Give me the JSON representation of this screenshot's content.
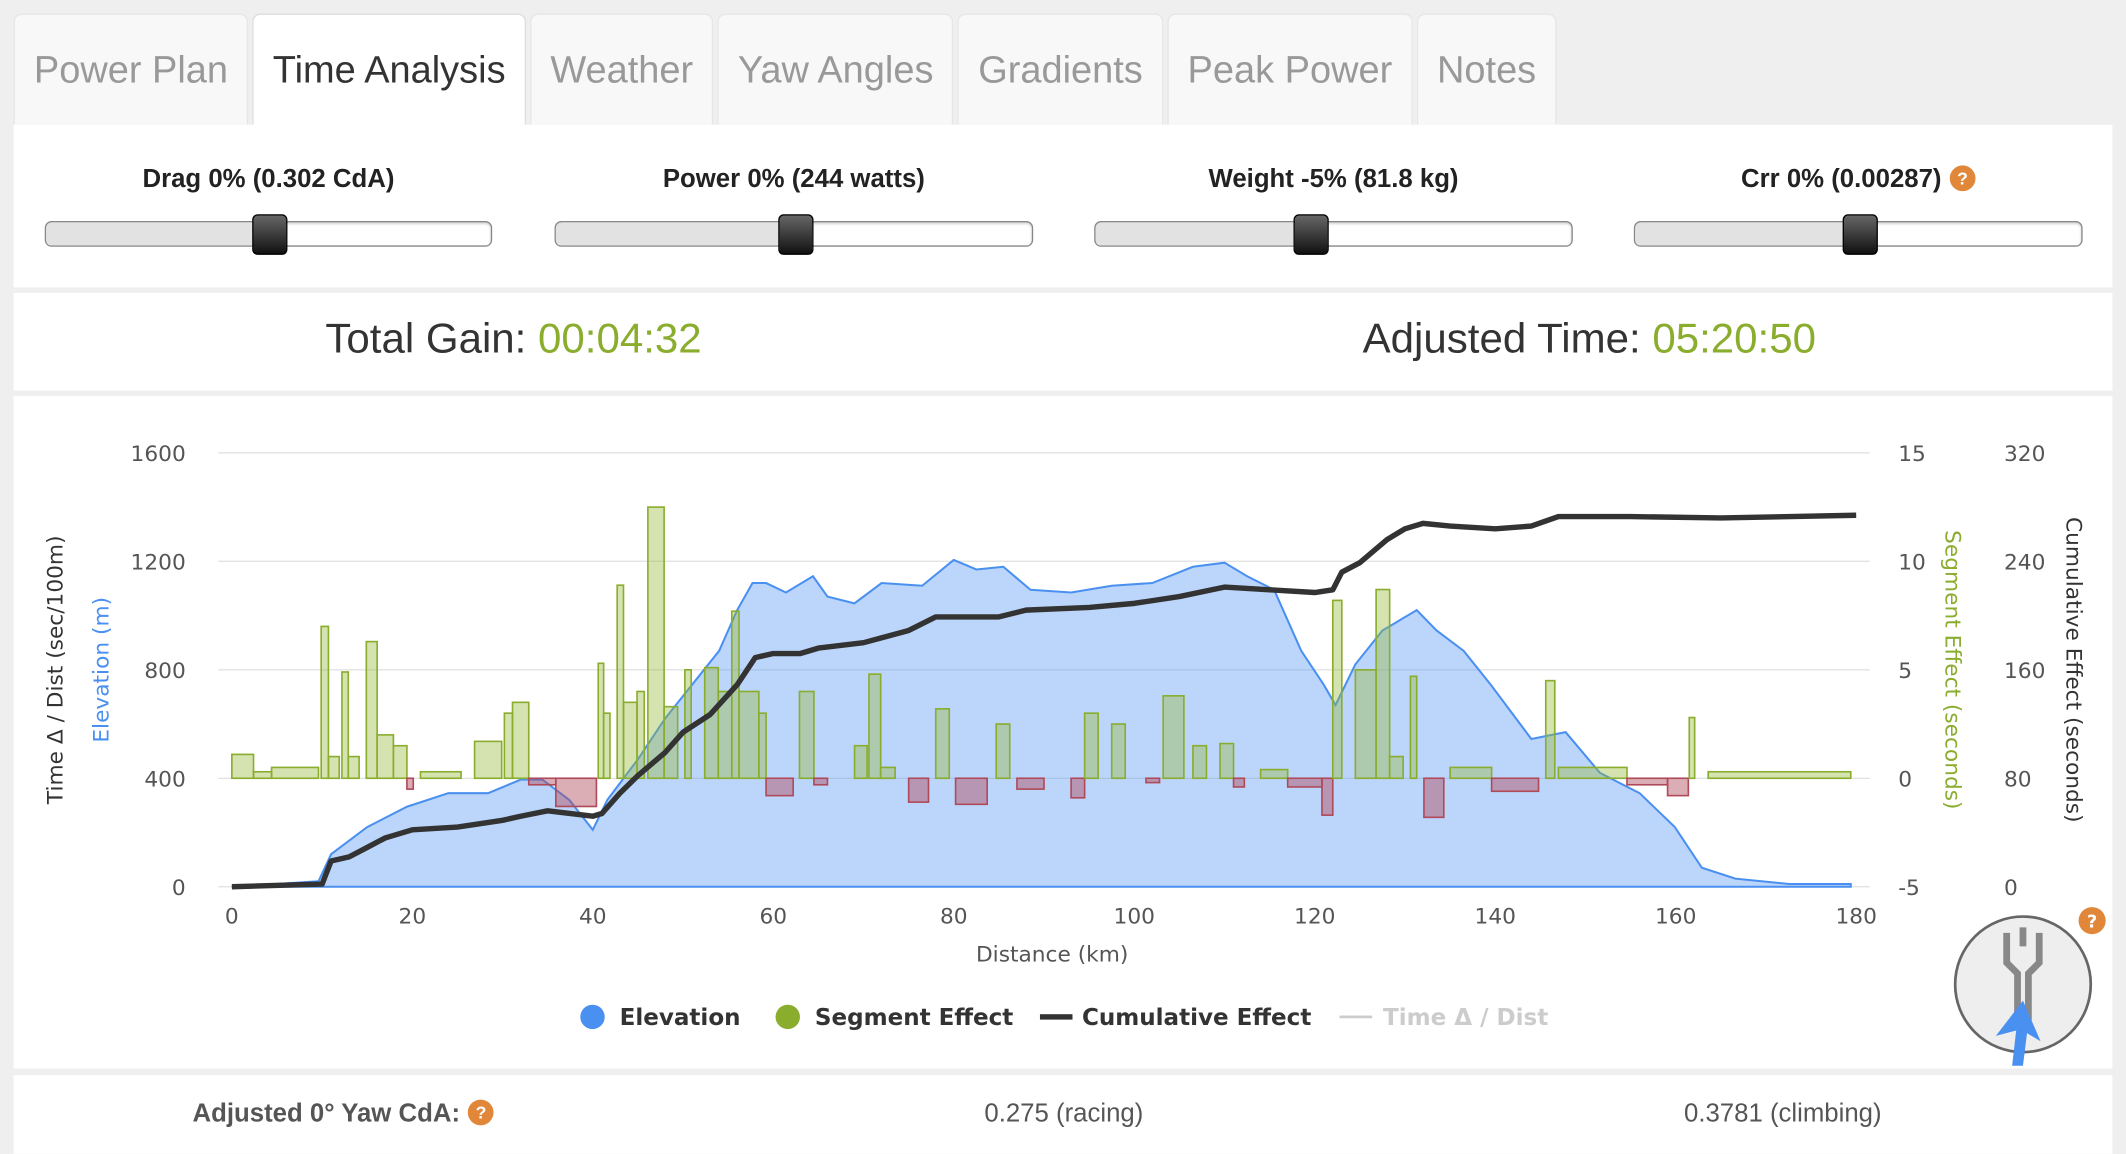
{
  "tabs": [
    {
      "label": "Power Plan"
    },
    {
      "label": "Time Analysis",
      "active": true
    },
    {
      "label": "Weather"
    },
    {
      "label": "Yaw Angles"
    },
    {
      "label": "Gradients"
    },
    {
      "label": "Peak Power"
    },
    {
      "label": "Notes"
    }
  ],
  "sliders": [
    {
      "label": "Drag 0% (0.302 CdA)",
      "position": 0.5
    },
    {
      "label": "Power 0% (244 watts)",
      "position": 0.5
    },
    {
      "label": "Weight -5% (81.8 kg)",
      "position": 0.45
    },
    {
      "label": "Crr 0% (0.00287)",
      "position": 0.5,
      "help": "?"
    }
  ],
  "totals": {
    "gain_label": "Total Gain:",
    "gain_value": "00:04:32",
    "adjusted_label": "Adjusted Time:",
    "adjusted_value": "05:20:50"
  },
  "colors": {
    "accent_green": "#8aad2e",
    "elevation_blue": "#4a90f0",
    "negative_red": "#b04a5a",
    "help_orange": "#e0873a"
  },
  "chart_data": {
    "type": "area",
    "xlabel": "Distance (km)",
    "xlim": [
      0,
      180
    ],
    "xticks": [
      "0",
      "20",
      "40",
      "60",
      "80",
      "100",
      "120",
      "140",
      "160",
      "180"
    ],
    "y_left_labels": [
      "Time Δ / Dist (sec/100m)",
      "Elevation (m)"
    ],
    "y_left_ticks": [
      "0",
      "400",
      "800",
      "1200",
      "1600"
    ],
    "y_left_lim": [
      0,
      1600
    ],
    "y_seg_label": "Segment Effect (seconds)",
    "y_seg_ticks": [
      "-5",
      "0",
      "5",
      "10",
      "15"
    ],
    "y_seg_lim": [
      -5,
      15
    ],
    "y_cum_label": "Cumulative Effect (seconds)",
    "y_cum_ticks": [
      "0",
      "80",
      "160",
      "240",
      "320"
    ],
    "y_cum_lim": [
      0,
      320
    ],
    "grid": true,
    "legend_position": "bottom",
    "legend": [
      {
        "name": "Elevation",
        "color": "#4a90f0"
      },
      {
        "name": "Segment Effect",
        "color": "#8aad2e"
      },
      {
        "name": "Cumulative Effect",
        "color": "#333333"
      },
      {
        "name": "Time Δ / Dist",
        "color": "#cccccc",
        "hidden": true
      }
    ],
    "elevation": [
      [
        0,
        0
      ],
      [
        9.6,
        20
      ],
      [
        11,
        120
      ],
      [
        15,
        220
      ],
      [
        19.4,
        295
      ],
      [
        24,
        345
      ],
      [
        28.4,
        345
      ],
      [
        32,
        395
      ],
      [
        34.4,
        395
      ],
      [
        37.4,
        320
      ],
      [
        40,
        210
      ],
      [
        41.6,
        320
      ],
      [
        45,
        470
      ],
      [
        48,
        620
      ],
      [
        51,
        745
      ],
      [
        54,
        870
      ],
      [
        56,
        1020
      ],
      [
        57.7,
        1120
      ],
      [
        59.2,
        1120
      ],
      [
        61.4,
        1085
      ],
      [
        64.4,
        1145
      ],
      [
        66,
        1070
      ],
      [
        69,
        1045
      ],
      [
        72,
        1120
      ],
      [
        76.5,
        1110
      ],
      [
        80,
        1205
      ],
      [
        82.5,
        1170
      ],
      [
        85.5,
        1180
      ],
      [
        88.5,
        1095
      ],
      [
        93,
        1085
      ],
      [
        97.5,
        1110
      ],
      [
        102,
        1120
      ],
      [
        106.5,
        1180
      ],
      [
        110,
        1195
      ],
      [
        112.5,
        1145
      ],
      [
        115.5,
        1095
      ],
      [
        118.5,
        870
      ],
      [
        121,
        745
      ],
      [
        122.3,
        670
      ],
      [
        124.5,
        820
      ],
      [
        127.5,
        945
      ],
      [
        131.3,
        1020
      ],
      [
        133.5,
        945
      ],
      [
        136.5,
        870
      ],
      [
        139.5,
        745
      ],
      [
        144,
        545
      ],
      [
        147.8,
        570
      ],
      [
        151.6,
        420
      ],
      [
        156,
        345
      ],
      [
        159.9,
        220
      ],
      [
        162.9,
        70
      ],
      [
        166.6,
        30
      ],
      [
        172.6,
        10
      ],
      [
        179.4,
        10
      ]
    ],
    "segment_effect": [
      [
        0,
        2.4,
        1.1
      ],
      [
        2.4,
        4.4,
        0.3
      ],
      [
        4.4,
        9.6,
        0.5
      ],
      [
        9.9,
        10.7,
        7
      ],
      [
        10.7,
        11.9,
        1
      ],
      [
        12.2,
        12.9,
        4.9
      ],
      [
        12.9,
        14.1,
        1
      ],
      [
        14.9,
        16.1,
        6.3
      ],
      [
        16.1,
        17.9,
        2
      ],
      [
        17.9,
        19.4,
        1.5
      ],
      [
        19.4,
        20.1,
        -0.5
      ],
      [
        20.9,
        25.4,
        0.3
      ],
      [
        26.9,
        29.9,
        1.7
      ],
      [
        30.2,
        31.1,
        3
      ],
      [
        31.1,
        32.9,
        3.5
      ],
      [
        32.9,
        35.9,
        -0.3
      ],
      [
        35.9,
        40.4,
        -1.3
      ],
      [
        40.6,
        41.2,
        5.3
      ],
      [
        41.2,
        41.9,
        3
      ],
      [
        42.7,
        43.4,
        8.9
      ],
      [
        43.4,
        44.9,
        3.5
      ],
      [
        44.9,
        45.7,
        4
      ],
      [
        46.1,
        47.9,
        12.5
      ],
      [
        47.9,
        49.4,
        3.3
      ],
      [
        50.2,
        50.9,
        5
      ],
      [
        52.4,
        53.9,
        5.1
      ],
      [
        53.9,
        55.4,
        4
      ],
      [
        55.4,
        56.2,
        7.7
      ],
      [
        56.2,
        58.4,
        4
      ],
      [
        58.4,
        59.2,
        3
      ],
      [
        59.2,
        62.2,
        -0.8
      ],
      [
        62.9,
        64.5,
        4
      ],
      [
        64.5,
        66,
        -0.3
      ],
      [
        69,
        70.4,
        1.5
      ],
      [
        70.6,
        71.9,
        4.8
      ],
      [
        71.9,
        73.5,
        0.5
      ],
      [
        75,
        77.2,
        -1.1
      ],
      [
        78,
        79.5,
        3.2
      ],
      [
        80.2,
        83.7,
        -1.2
      ],
      [
        84.7,
        86.2,
        2.5
      ],
      [
        87,
        90,
        -0.5
      ],
      [
        93,
        94.5,
        -0.9
      ],
      [
        94.5,
        96,
        3
      ],
      [
        97.5,
        99,
        2.5
      ],
      [
        101.3,
        102.8,
        -0.2
      ],
      [
        103.2,
        105.5,
        3.8
      ],
      [
        106.5,
        108,
        1.5
      ],
      [
        109.5,
        111,
        1.6
      ],
      [
        111,
        112.2,
        -0.4
      ],
      [
        114,
        117,
        0.4
      ],
      [
        117,
        120.8,
        -0.4
      ],
      [
        120.8,
        122,
        -1.7
      ],
      [
        122,
        123,
        8.2
      ],
      [
        124.5,
        126.8,
        5
      ],
      [
        126.8,
        128.3,
        8.7
      ],
      [
        128.3,
        129.8,
        1
      ],
      [
        130.6,
        131.3,
        4.7
      ],
      [
        132.1,
        134.3,
        -1.8
      ],
      [
        135,
        139.6,
        0.5
      ],
      [
        139.6,
        144.8,
        -0.6
      ],
      [
        145.6,
        146.6,
        4.5
      ],
      [
        147,
        154.6,
        0.5
      ],
      [
        154.6,
        159.1,
        -0.3
      ],
      [
        159.1,
        161.4,
        -0.8
      ],
      [
        161.5,
        162.1,
        2.8
      ],
      [
        163.6,
        179.4,
        0.3
      ]
    ],
    "cumulative_effect": [
      [
        0,
        0
      ],
      [
        10,
        2
      ],
      [
        11,
        19
      ],
      [
        13,
        22
      ],
      [
        15,
        29
      ],
      [
        17,
        36
      ],
      [
        20,
        42
      ],
      [
        25,
        44
      ],
      [
        30,
        49
      ],
      [
        32,
        52
      ],
      [
        35,
        56
      ],
      [
        40,
        52
      ],
      [
        41,
        54
      ],
      [
        43,
        69
      ],
      [
        45,
        82
      ],
      [
        48,
        99
      ],
      [
        50,
        114
      ],
      [
        53,
        127
      ],
      [
        56,
        149
      ],
      [
        58,
        169
      ],
      [
        60,
        172
      ],
      [
        63,
        172
      ],
      [
        65,
        176
      ],
      [
        70,
        180
      ],
      [
        75,
        189
      ],
      [
        78,
        199
      ],
      [
        85,
        199
      ],
      [
        88,
        204
      ],
      [
        95,
        206
      ],
      [
        100,
        209
      ],
      [
        105,
        214
      ],
      [
        110,
        221
      ],
      [
        115,
        219
      ],
      [
        120,
        217
      ],
      [
        122,
        219
      ],
      [
        123,
        232
      ],
      [
        125,
        239
      ],
      [
        128,
        256
      ],
      [
        130,
        264
      ],
      [
        132,
        268
      ],
      [
        135,
        266
      ],
      [
        140,
        264
      ],
      [
        144,
        266
      ],
      [
        147,
        273
      ],
      [
        155,
        273
      ],
      [
        165,
        272
      ],
      [
        180,
        274
      ]
    ]
  },
  "footer": {
    "label": "Adjusted 0° Yaw CdA:",
    "help": "?",
    "racing": "0.275 (racing)",
    "climbing": "0.3781 (climbing)"
  },
  "corner_help": "?"
}
